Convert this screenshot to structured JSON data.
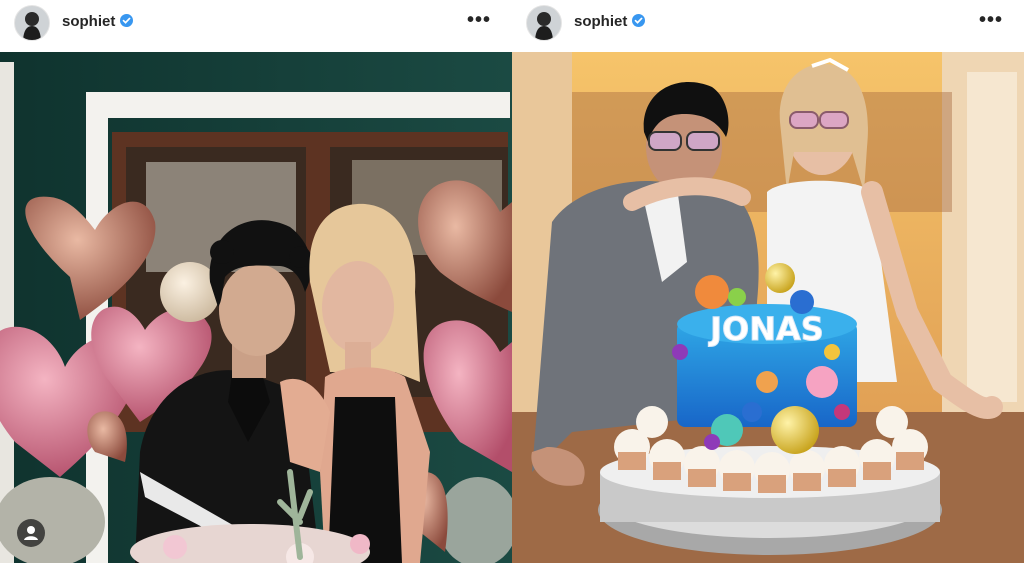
{
  "posts": [
    {
      "username": "sophiet",
      "verified": true,
      "more_label": "•••",
      "avatar_icon": "profile-avatar",
      "has_tag_button": true
    },
    {
      "username": "sophiet",
      "verified": true,
      "more_label": "•••",
      "avatar_icon": "profile-avatar",
      "cake_text": "JONAS"
    }
  ],
  "colors": {
    "verified_blue": "#3897f0",
    "text": "#262626"
  }
}
